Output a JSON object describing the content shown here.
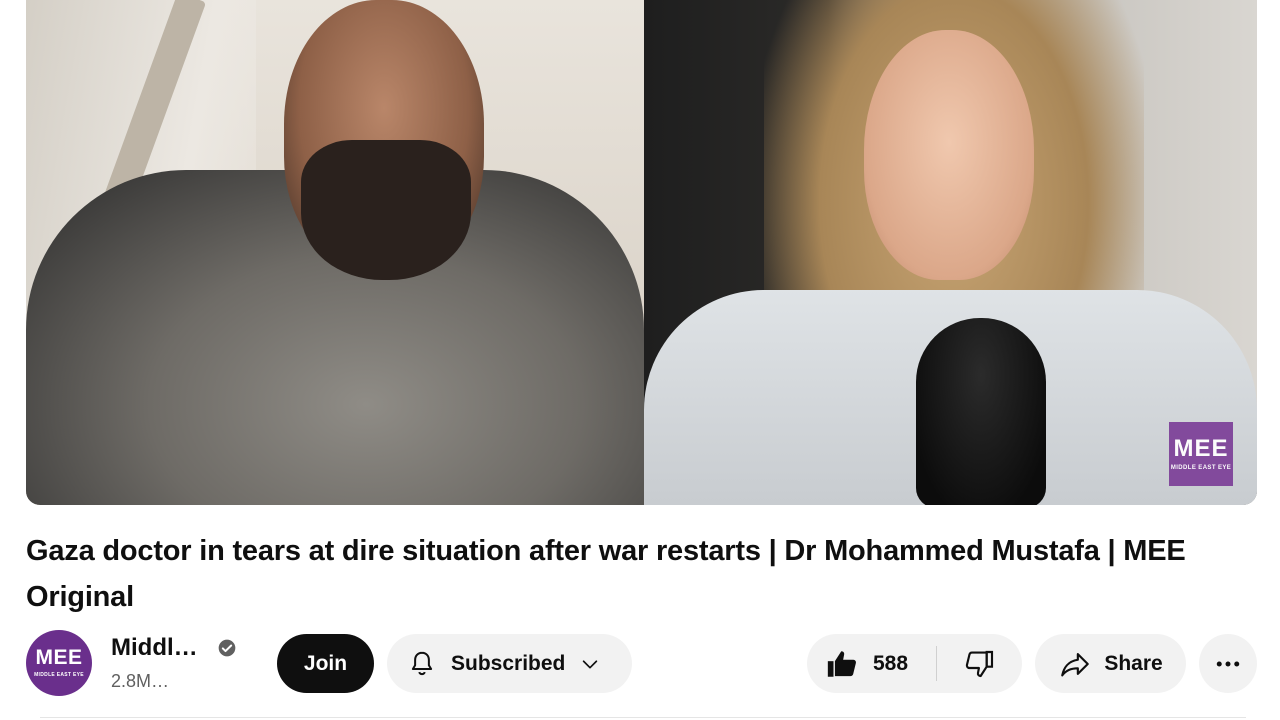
{
  "video": {
    "title": "Gaza doctor in tears at dire situation after war restarts | Dr Mohammed Mustafa | MEE Original",
    "watermark_big": "MEE",
    "watermark_small": "MIDDLE EAST EYE"
  },
  "channel": {
    "avatar_big": "MEE",
    "avatar_small": "MIDDLE EAST EYE",
    "name": "Middl…",
    "subscribers": "2.8M…",
    "verified_icon": "check-circle-icon",
    "brand_color": "#6a2f8c"
  },
  "actions": {
    "join_label": "Join",
    "subscribed_label": "Subscribed",
    "like_count": "588",
    "share_label": "Share"
  },
  "icons": {
    "bell": "bell-icon",
    "chevron": "chevron-down-icon",
    "like": "thumbs-up-icon",
    "dislike": "thumbs-down-icon",
    "share": "share-arrow-icon",
    "more": "more-horizontal-icon"
  }
}
